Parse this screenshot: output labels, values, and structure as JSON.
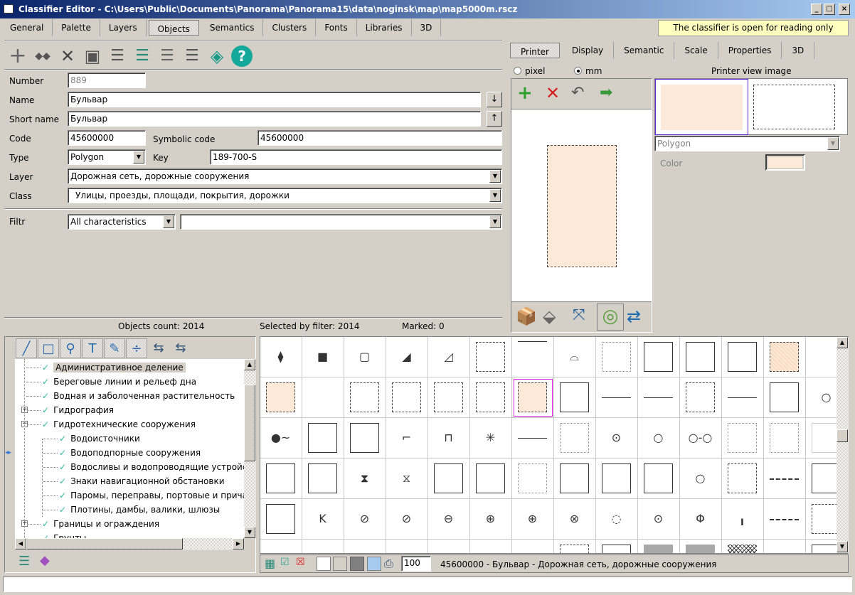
{
  "window": {
    "title": "Classifier Editor - C:\\Users\\Public\\Documents\\Panorama\\Panorama15\\data\\noginsk\\map\\map5000m.rscz"
  },
  "main_tabs": [
    "General",
    "Palette",
    "Layers",
    "Objects",
    "Semantics",
    "Clusters",
    "Fonts",
    "Libraries",
    "3D"
  ],
  "active_main_tab": "Objects",
  "notice": "The classifier is open for reading only",
  "toolbar_icons": [
    "add-icon",
    "copy-icon",
    "delete-icon",
    "save-icon",
    "checklist-icon",
    "list-copy-icon",
    "list-paste-icon",
    "list-remove-icon",
    "layers-icon",
    "help-icon"
  ],
  "form": {
    "number_label": "Number",
    "number": "889",
    "name_label": "Name",
    "name": "Бульвар",
    "short_name_label": "Short name",
    "short_name": "Бульвар",
    "code_label": "Code",
    "code": "45600000",
    "symbolic_code_label": "Symbolic code",
    "symbolic_code": "45600000",
    "type_label": "Type",
    "type": "Polygon",
    "key_label": "Key",
    "key": "189-700-S",
    "layer_label": "Layer",
    "layer": "Дорожная сеть, дорожные сооружения",
    "class_label": "Class",
    "class": "Улицы, проезды, площади, покрытия, дорожки",
    "filter_label": "Filtr",
    "filter": "All characteristics",
    "filter_value": ""
  },
  "counts": {
    "objects": "Objects count: 2014",
    "selected": "Selected by filter: 2014",
    "marked": "Marked: 0"
  },
  "right_tabs": [
    "Printer",
    "Display",
    "Semantic",
    "Scale",
    "Properties",
    "3D"
  ],
  "active_right_tab": "Printer",
  "units": {
    "pixel": "pixel",
    "mm": "mm",
    "selected": "mm"
  },
  "printer_view_label": "Printer view image",
  "primitive_type": "Polygon",
  "color_label": "Color",
  "color_value": "#fde9d7",
  "tree": [
    {
      "label": "Административное деление",
      "level": 0,
      "selected": true
    },
    {
      "label": "Береговые линии и рельеф дна",
      "level": 0
    },
    {
      "label": "Водная и заболоченная растительность",
      "level": 0
    },
    {
      "label": "Гидрография",
      "level": 0,
      "expander": "+"
    },
    {
      "label": "Гидротехнические сооружения",
      "level": 0,
      "expander": "−"
    },
    {
      "label": "Водоисточники",
      "level": 1
    },
    {
      "label": "Водоподпорные сооружения",
      "level": 1
    },
    {
      "label": "Водосливы и водопроводящие устройства",
      "level": 1
    },
    {
      "label": "Знаки навигационной обстановки",
      "level": 1
    },
    {
      "label": "Паромы, переправы, портовые и причальные",
      "level": 1
    },
    {
      "label": "Плотины, дамбы, валики, шлюзы",
      "level": 1
    },
    {
      "label": "Границы и ограждения",
      "level": 0,
      "expander": "+"
    },
    {
      "label": "Грунты",
      "level": 0
    }
  ],
  "grid_rows": [
    [
      "glyph:⧫",
      "glyph:■",
      "glyph:▢",
      "glyph:◢",
      "glyph:◿",
      "dashed",
      "line-top",
      "glyph:⌓",
      "dotted",
      "rect",
      "rect",
      "rect",
      "hatch",
      "empty"
    ],
    [
      "peach",
      "empty",
      "dashed",
      "dashed",
      "dashed",
      "dashed",
      "peach-selected",
      "rect",
      "line",
      "line",
      "dashed",
      "line",
      "rect",
      "glyph:○"
    ],
    [
      "glyph:●~",
      "rect",
      "rect",
      "glyph:⌐",
      "glyph:⊓",
      "glyph:✳",
      "line",
      "dotted",
      "glyph:⊙",
      "glyph:○",
      "glyph:○-○",
      "dotted",
      "dotted",
      "rect-light"
    ],
    [
      "rect",
      "rect",
      "glyph:⧗",
      "glyph:⧖",
      "rect",
      "rect",
      "dotted",
      "rect",
      "rect",
      "rect",
      "glyph:○",
      "dashed",
      "dash-line",
      "rect"
    ],
    [
      "rect",
      "glyph:K",
      "glyph:⊘",
      "glyph:⊘",
      "glyph:⊖",
      "glyph:⊕",
      "glyph:⊕",
      "glyph:⊗",
      "glyph:◌",
      "glyph:⊙",
      "glyph:Φ",
      "glyph:╻",
      "dash-line",
      "dashed"
    ],
    [
      "empty",
      "empty",
      "empty",
      "empty",
      "empty",
      "empty",
      "empty",
      "dashed",
      "rect",
      "gray",
      "gray",
      "crosshatch",
      "empty",
      "rect"
    ]
  ],
  "zoom_value": "100",
  "status_line": "45600000 - Бульвар - Дорожная сеть, дорожные сооружения"
}
